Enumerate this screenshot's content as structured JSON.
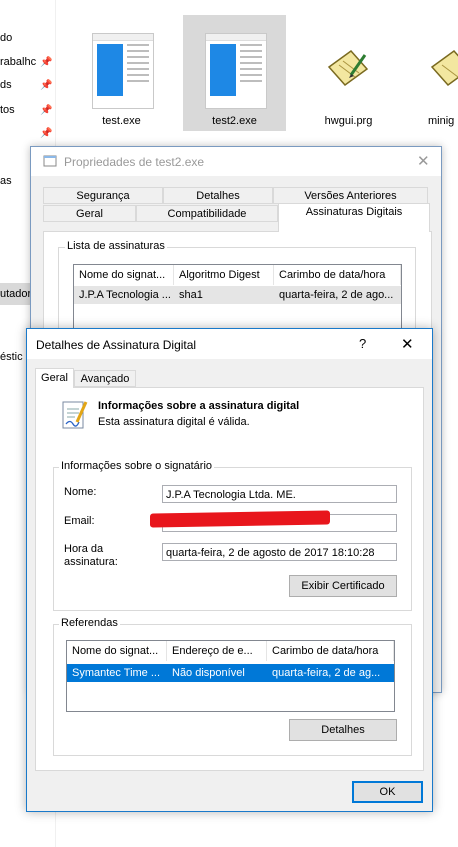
{
  "explorer": {
    "nav_items": [
      "do",
      "rabalhc",
      "ds",
      "tos",
      "as",
      "utador",
      "éstic"
    ],
    "files": [
      {
        "name": "test.exe",
        "icon": "exe-window-icon"
      },
      {
        "name": "test2.exe",
        "icon": "exe-window-icon"
      },
      {
        "name": "hwgui.prg",
        "icon": "prg-file-icon"
      },
      {
        "name": "minig",
        "icon": "prg-file-icon"
      }
    ]
  },
  "properties": {
    "title": "Propriedades de test2.exe",
    "tabs_row1": [
      "Segurança",
      "Detalhes",
      "Versões Anteriores"
    ],
    "tabs_row2": [
      "Geral",
      "Compatibilidade",
      "Assinaturas Digitais"
    ],
    "group_label": "Lista de assinaturas",
    "columns": [
      "Nome do signat...",
      "Algoritmo Digest",
      "Carimbo de data/hora"
    ],
    "rows": [
      [
        "J.P.A Tecnologia ...",
        "sha1",
        "quarta-feira, 2 de ago..."
      ]
    ]
  },
  "details": {
    "title": "Detalhes de Assinatura Digital",
    "help": "?",
    "tabs": [
      "Geral",
      "Avançado"
    ],
    "info_heading": "Informações sobre a assinatura digital",
    "info_sub": "Esta assinatura digital é válida.",
    "signer_group": "Informações sobre o signatário",
    "name_label": "Nome:",
    "name_value": "J.P.A Tecnologia Ltda. ME.",
    "email_label": "Email:",
    "email_value": "",
    "time_label_1": "Hora da",
    "time_label_2": "assinatura:",
    "time_value": "quarta-feira, 2 de agosto de 2017 18:10:28",
    "view_cert_button": "Exibir Certificado",
    "refs_group": "Referendas",
    "refs_columns": [
      "Nome do signat...",
      "Endereço de e...",
      "Carimbo de data/hora"
    ],
    "refs_rows": [
      [
        "Symantec Time ...",
        "Não disponível",
        "quarta-feira, 2 de ag..."
      ]
    ],
    "details_button": "Detalhes",
    "ok_button": "OK"
  },
  "colors": {
    "selection": "#0078d7",
    "redaction": "#e8161c"
  }
}
